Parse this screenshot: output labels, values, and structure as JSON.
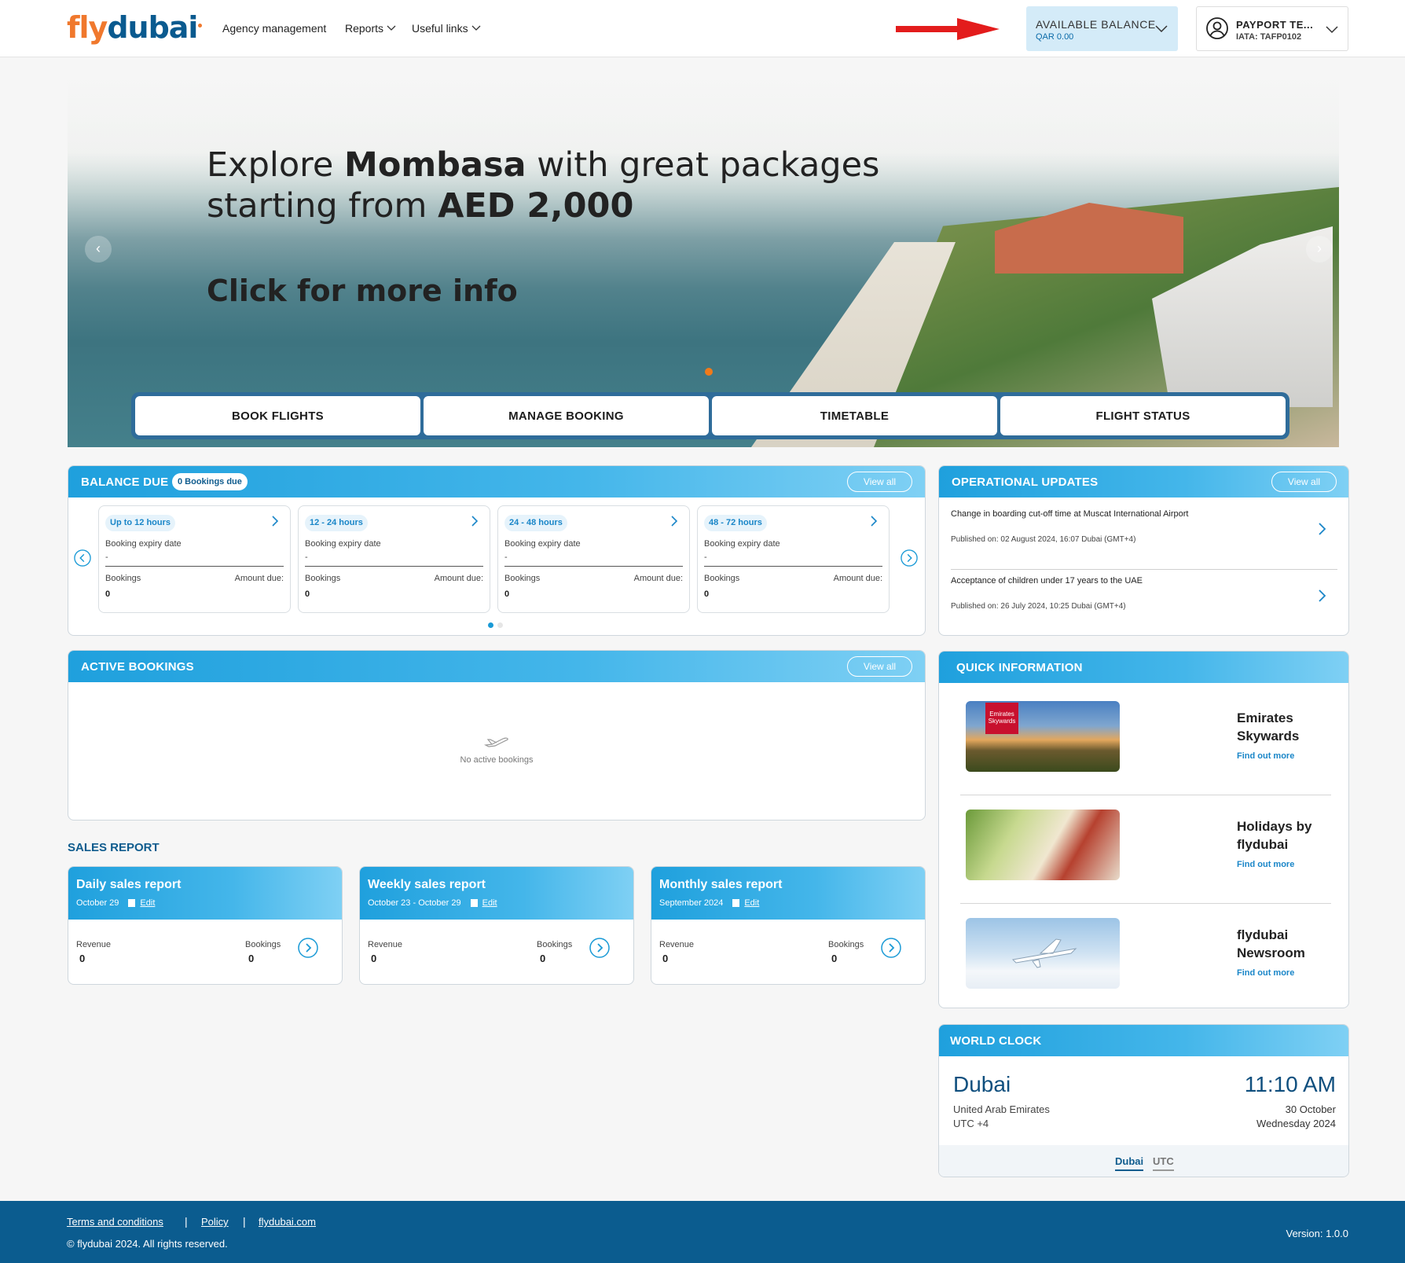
{
  "header": {
    "logo_fly": "fly",
    "logo_dubai": "dubai",
    "nav": {
      "agency": "Agency management",
      "reports": "Reports",
      "useful": "Useful links"
    },
    "balance": {
      "label": "AVAILABLE BALANCE",
      "value": "QAR 0.00"
    },
    "profile": {
      "name": "PAYPORT TE...",
      "iata": "IATA: TAFP0102"
    },
    "colors": {
      "accent_arrow": "#e31c1c",
      "brand_blue": "#0a5a8f",
      "brand_orange": "#f0782d"
    }
  },
  "hero": {
    "line1_pre": "Explore ",
    "line1_bold": "Mombasa",
    "line1_post": " with great packages",
    "line2_pre": "starting from ",
    "line2_bold": "AED 2,000",
    "cta": "Click for more info",
    "tabs": [
      "BOOK FLIGHTS",
      "MANAGE BOOKING",
      "TIMETABLE",
      "FLIGHT STATUS"
    ]
  },
  "balance_due": {
    "title": "BALANCE DUE",
    "badge": "0 Bookings due",
    "view_all": "View all",
    "tiles": [
      {
        "range": "Up to 12 hours",
        "expiry_label": "Booking expiry date",
        "expiry": "-",
        "bookings_label": "Bookings",
        "amount_label": "Amount due:",
        "bookings": "0"
      },
      {
        "range": "12 - 24 hours",
        "expiry_label": "Booking expiry date",
        "expiry": "-",
        "bookings_label": "Bookings",
        "amount_label": "Amount due:",
        "bookings": "0"
      },
      {
        "range": "24 - 48 hours",
        "expiry_label": "Booking expiry date",
        "expiry": "-",
        "bookings_label": "Bookings",
        "amount_label": "Amount due:",
        "bookings": "0"
      },
      {
        "range": "48 - 72 hours",
        "expiry_label": "Booking expiry date",
        "expiry": "-",
        "bookings_label": "Bookings",
        "amount_label": "Amount due:",
        "bookings": "0"
      }
    ]
  },
  "operational": {
    "title": "OPERATIONAL UPDATES",
    "view_all": "View all",
    "items": [
      {
        "title": "Change in boarding cut-off time at Muscat International Airport",
        "published": "Published on: 02 August 2024, 16:07 Dubai (GMT+4)"
      },
      {
        "title": "Acceptance of children under 17 years to the UAE",
        "published": "Published on: 26 July 2024, 10:25 Dubai (GMT+4)"
      }
    ]
  },
  "active": {
    "title": "ACTIVE BOOKINGS",
    "view_all": "View all",
    "empty": "No active bookings"
  },
  "sales": {
    "title": "SALES REPORT",
    "cards": [
      {
        "title": "Daily sales report",
        "range": "October 29",
        "edit": "Edit",
        "revenue_label": "Revenue",
        "revenue": "0",
        "bookings_label": "Bookings",
        "bookings": "0"
      },
      {
        "title": "Weekly sales report",
        "range": "October 23 - October 29",
        "edit": "Edit",
        "revenue_label": "Revenue",
        "revenue": "0",
        "bookings_label": "Bookings",
        "bookings": "0"
      },
      {
        "title": "Monthly sales report",
        "range": "September 2024",
        "edit": "Edit",
        "revenue_label": "Revenue",
        "revenue": "0",
        "bookings_label": "Bookings",
        "bookings": "0"
      }
    ]
  },
  "quick": {
    "title": "QUICK INFORMATION",
    "items": [
      {
        "name": "Emirates Skywards",
        "link": "Find out more",
        "logo_text": "Emirates Skywards"
      },
      {
        "name": "Holidays by flydubai",
        "link": "Find out more"
      },
      {
        "name": "flydubai Newsroom",
        "link": "Find out more"
      }
    ]
  },
  "clock": {
    "title": "WORLD CLOCK",
    "city": "Dubai",
    "country": "United Arab Emirates",
    "utc": "UTC +4",
    "time": "11:10 AM",
    "date1": "30 October",
    "date2": "Wednesday 2024",
    "tabs": [
      "Dubai",
      "UTC"
    ]
  },
  "footer": {
    "links": [
      "Terms and conditions",
      "Policy",
      "flydubai.com"
    ],
    "separator": "|",
    "copyright": "© flydubai 2024. All rights reserved.",
    "version": "Version: 1.0.0"
  }
}
